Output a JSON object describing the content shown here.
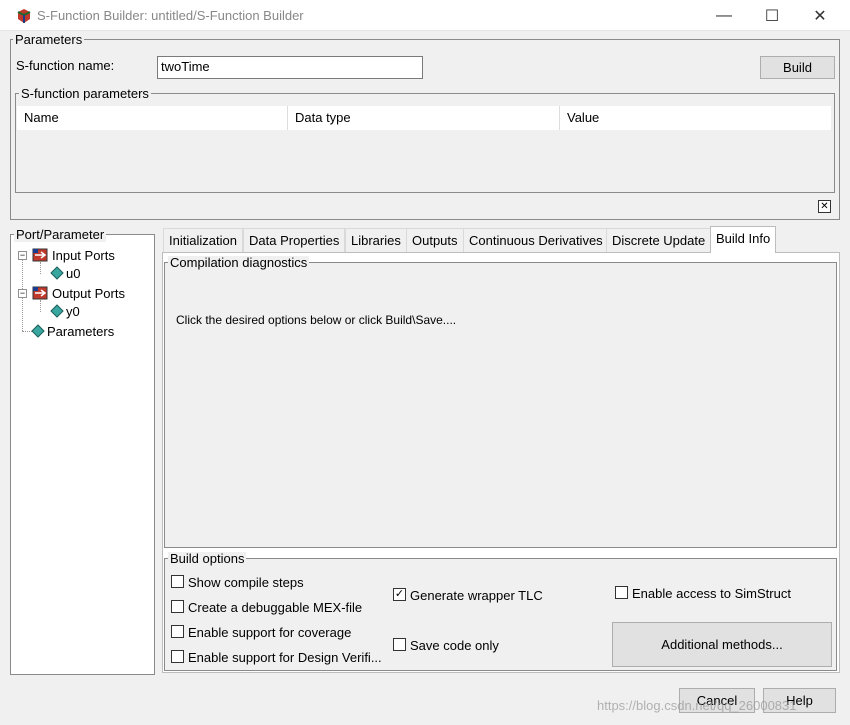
{
  "window": {
    "title": "S-Function Builder: untitled/S-Function Builder",
    "controls": {
      "minimize": "—",
      "maximize": "☐",
      "close": "✕"
    }
  },
  "parameters": {
    "group_label": "Parameters",
    "sfunction_name_label": "S-function name:",
    "sfunction_name_value": "twoTime",
    "build_button": "Build",
    "sfunction_params_label": "S-function parameters",
    "table_columns": [
      "Name",
      "Data type",
      "Value"
    ],
    "close_glyph": "✕"
  },
  "port_parameter": {
    "group_label": "Port/Parameter",
    "tree": [
      {
        "label": "Input Ports",
        "expander": "−",
        "children": [
          "u0"
        ]
      },
      {
        "label": "Output Ports",
        "expander": "−",
        "children": [
          "y0"
        ]
      },
      {
        "label": "Parameters"
      }
    ]
  },
  "tabs": [
    "Initialization",
    "Data Properties",
    "Libraries",
    "Outputs",
    "Continuous Derivatives",
    "Discrete Update",
    "Build Info"
  ],
  "active_tab": "Build Info",
  "compilation": {
    "group_label": "Compilation diagnostics",
    "message": "Click the desired options below or click Build\\Save...."
  },
  "build_options": {
    "group_label": "Build options",
    "show_compile_steps": {
      "label": "Show compile steps",
      "checked": false
    },
    "debuggable_mex": {
      "label": "Create a debuggable MEX-file",
      "checked": false
    },
    "coverage": {
      "label": "Enable support for coverage",
      "checked": false
    },
    "design_verifier": {
      "label": "Enable support for Design Verifi...",
      "checked": false
    },
    "wrapper_tlc": {
      "label": "Generate wrapper TLC",
      "checked": true
    },
    "save_code_only": {
      "label": "Save code only",
      "checked": false
    },
    "simstruct": {
      "label": "Enable access to SimStruct",
      "checked": false
    },
    "additional_methods": "Additional methods...",
    "check_glyph": "✓"
  },
  "footer": {
    "cancel": "Cancel",
    "help": "Help",
    "watermark": "https://blog.csdn.net/qq_26000831"
  }
}
